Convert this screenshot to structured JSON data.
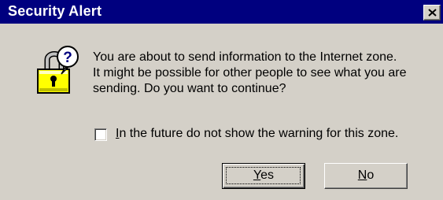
{
  "window": {
    "title": "Security Alert",
    "close_symbol": "×"
  },
  "icons": {
    "close": "close-icon",
    "dialog": "padlock-question-icon"
  },
  "message": {
    "line1": "You are about to send information to the Internet zone.",
    "line2": "It might be possible for other people to see what you are",
    "line3": "sending. Do you want to continue?"
  },
  "checkbox": {
    "checked": false,
    "label_accel": "I",
    "label_rest": "n the future do not show the warning for this zone."
  },
  "buttons": {
    "yes_accel": "Y",
    "yes_rest": "es",
    "no_accel": "N",
    "no_rest": "o"
  },
  "colors": {
    "titlebar": "#00007f",
    "face": "#d4d0c8",
    "lock_body": "#ffff00",
    "question_bubble": "#ffffff"
  }
}
